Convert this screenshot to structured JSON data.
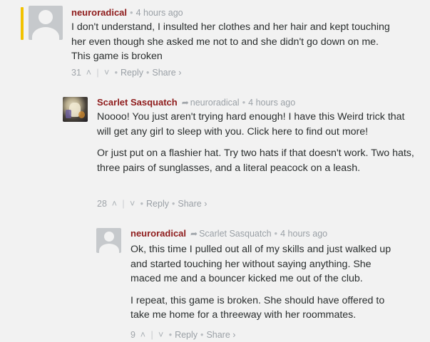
{
  "comments": [
    {
      "author": "neuroradical",
      "time": "4 hours ago",
      "paragraphs": [
        "I don't understand, I insulted her clothes and her hair and kept touching her even though she asked me not to and she didn't go down on me. This game is broken"
      ],
      "votes": "31",
      "reply_label": "Reply",
      "share_label": "Share ›",
      "avatar_icon": "default-avatar-icon"
    },
    {
      "author": "Scarlet Sasquatch",
      "replying_to": "neuroradical",
      "time": "4 hours ago",
      "paragraphs": [
        "Noooo! You just aren't trying hard enough! I have this Weird trick that will get any girl to sleep with you. Click here to find out more!",
        "Or just put on a flashier hat. Try two hats if that doesn't work. Two hats, three pairs of sunglasses, and a literal peacock on a leash."
      ],
      "votes": "28",
      "reply_label": "Reply",
      "share_label": "Share ›",
      "avatar_icon": "artwork-avatar-icon"
    },
    {
      "author": "neuroradical",
      "replying_to": "Scarlet Sasquatch",
      "time": "4 hours ago",
      "paragraphs": [
        "Ok, this time I pulled out all of my skills and just walked up and started touching her without saying anything. She maced me and a bouncer kicked me out of the club.",
        "I repeat, this game is broken. She should have offered to take me home for a threeway with her roommates."
      ],
      "votes": "9",
      "reply_label": "Reply",
      "share_label": "Share ›",
      "avatar_icon": "default-avatar-icon"
    }
  ],
  "icons": {
    "upvote": "˄",
    "downvote": "˅",
    "bullet": "•",
    "reply_arrow": "➦"
  },
  "colors": {
    "author": "#8e1b1b",
    "highlight": "#f2c200",
    "background": "#f2f2f2"
  }
}
